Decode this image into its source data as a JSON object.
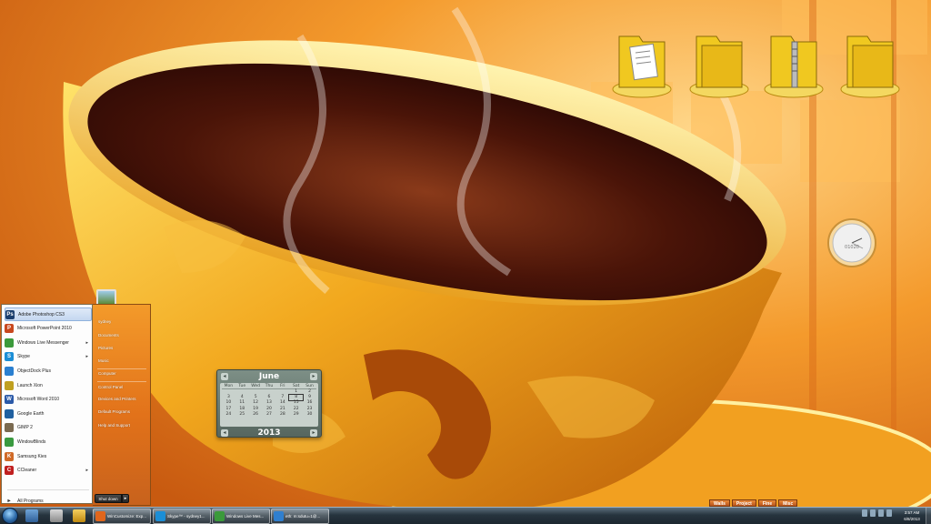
{
  "desktop": {
    "folders": [
      {
        "icon": "document-folder-icon"
      },
      {
        "icon": "folder-icon"
      },
      {
        "icon": "zip-folder-icon"
      },
      {
        "icon": "folder-icon"
      }
    ],
    "clock_label": "01020"
  },
  "calendar": {
    "month": "June",
    "year": "2013",
    "weekdays": [
      "Mon",
      "Tue",
      "Wed",
      "Thu",
      "Fri",
      "Sat",
      "Sun"
    ],
    "days": [
      "",
      "",
      "",
      "",
      "",
      "1",
      "2",
      "3",
      "4",
      "5",
      "6",
      "7",
      "8",
      "9",
      "10",
      "11",
      "12",
      "13",
      "14",
      "15",
      "16",
      "17",
      "18",
      "19",
      "20",
      "21",
      "22",
      "23",
      "24",
      "25",
      "26",
      "27",
      "28",
      "29",
      "30"
    ],
    "today": "8"
  },
  "start_menu": {
    "programs": [
      {
        "label": "Adobe Photoshop CS3",
        "icon": "photoshop-icon",
        "color": "#1b3f6e",
        "glyph": "Ps"
      },
      {
        "label": "Microsoft PowerPoint 2010",
        "icon": "powerpoint-icon",
        "color": "#c8481e",
        "glyph": "P"
      },
      {
        "label": "Windows Live Messenger",
        "icon": "messenger-icon",
        "color": "#3b9a3b",
        "glyph": "",
        "arrow": "▸"
      },
      {
        "label": "Skype",
        "icon": "skype-icon",
        "color": "#1b8ed6",
        "glyph": "S",
        "arrow": "▸"
      },
      {
        "label": "ObjectDock Plus",
        "icon": "objectdock-icon",
        "color": "#2a7fd0",
        "glyph": ""
      },
      {
        "label": "Launch Xion",
        "icon": "xion-icon",
        "color": "#c0a020",
        "glyph": ""
      },
      {
        "label": "Microsoft Word 2010",
        "icon": "word-icon",
        "color": "#2b5aa8",
        "glyph": "W"
      },
      {
        "label": "Google Earth",
        "icon": "google-earth-icon",
        "color": "#2060a0",
        "glyph": ""
      },
      {
        "label": "GIMP 2",
        "icon": "gimp-icon",
        "color": "#7a6a50",
        "glyph": ""
      },
      {
        "label": "WindowBlinds",
        "icon": "windowblinds-icon",
        "color": "#3a9a40",
        "glyph": ""
      },
      {
        "label": "Samsung Kies",
        "icon": "samsung-kies-icon",
        "color": "#d06a28",
        "glyph": "K"
      },
      {
        "label": "CCleaner",
        "icon": "ccleaner-icon",
        "color": "#c02020",
        "glyph": "C",
        "arrow": "▸"
      }
    ],
    "all_programs": "All Programs",
    "search_placeholder": "Search programs and files",
    "right_items": [
      "sydney",
      "Documents",
      "Pictures",
      "Music",
      "Computer",
      "Control Panel",
      "Devices and Printers",
      "Default Programs",
      "Help and Support"
    ],
    "shutdown_label": "Shut down",
    "shutdown_arrow": "▸"
  },
  "tabs": [
    "Walls",
    "Project",
    "Fine",
    "Misc"
  ],
  "taskbar": {
    "tasks": [
      {
        "label": "WinCustomize: Exp...",
        "icon": "firefox-icon",
        "color": "#e0661c"
      },
      {
        "label": "Skype™ - sydney1...",
        "icon": "skype-icon",
        "color": "#1b8ed6"
      },
      {
        "label": "Windows Live Mes...",
        "icon": "messenger-icon",
        "color": "#3b9a3b"
      },
      {
        "label": "eth: m:sdutu=1@...",
        "icon": "messenger-icon",
        "color": "#2f7fcf"
      }
    ],
    "time": "3:57 AM",
    "date": "6/8/2013"
  }
}
